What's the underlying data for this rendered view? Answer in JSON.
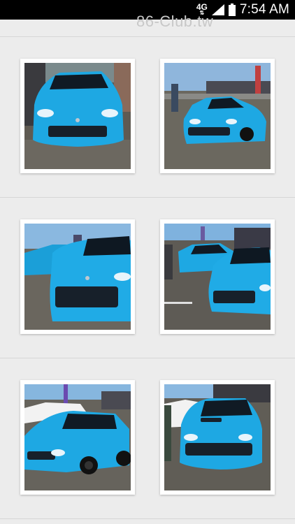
{
  "status_bar": {
    "network": "4G",
    "network_arrows": "⇅",
    "time": "7:54 AM"
  },
  "watermark": "86-Club.tw",
  "colors": {
    "car_blue": "#1da7e0",
    "background": "#ececec",
    "status_bar": "#000000"
  },
  "gallery": {
    "photos": [
      {
        "subject": "blue-brz-front"
      },
      {
        "subject": "blue-brz-angle"
      },
      {
        "subject": "blue-brz-closeup"
      },
      {
        "subject": "blue-brz-lot"
      },
      {
        "subject": "blue-wrx-sti-side"
      },
      {
        "subject": "blue-wrx-sti-front"
      }
    ]
  }
}
